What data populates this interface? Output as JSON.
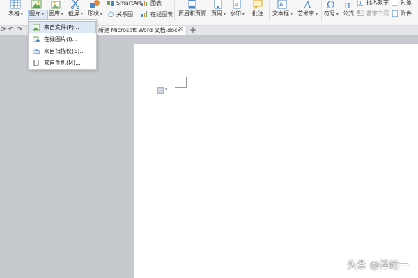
{
  "ribbon": {
    "table": "表格",
    "picture": "图片",
    "gallery": "图库",
    "screenshot": "截屏",
    "shapes": "形状",
    "smartart": "SmartArt",
    "chart": "图表",
    "relation": "关系图",
    "online_chart": "在线图表",
    "header_footer": "页眉和页脚",
    "page_number": "页码",
    "watermark": "水印",
    "comment": "批注",
    "textbox": "文本框",
    "wordart": "艺术字",
    "symbol": "符号",
    "formula": "公式",
    "insert_number": "插入数字",
    "object": "对象",
    "drop_cap": "首字下沉",
    "attachment": "附件"
  },
  "tab": {
    "title": "新建 Microsoft Word 文档.docx",
    "close": "×",
    "new": "+"
  },
  "dropdown": {
    "items": [
      {
        "label": "来自文件(P)..."
      },
      {
        "label": "在线图片(I)..."
      },
      {
        "label": "来自扫描仪(S)..."
      },
      {
        "label": "来自手机(M)..."
      }
    ]
  },
  "watermark_text": "头条 @泽蛇一",
  "colors": {
    "accent": "#4a86c8",
    "ribbon_bg": "#f6f6f6",
    "canvas_bg": "#c6c9ce",
    "highlight": "#dfe9f6"
  }
}
